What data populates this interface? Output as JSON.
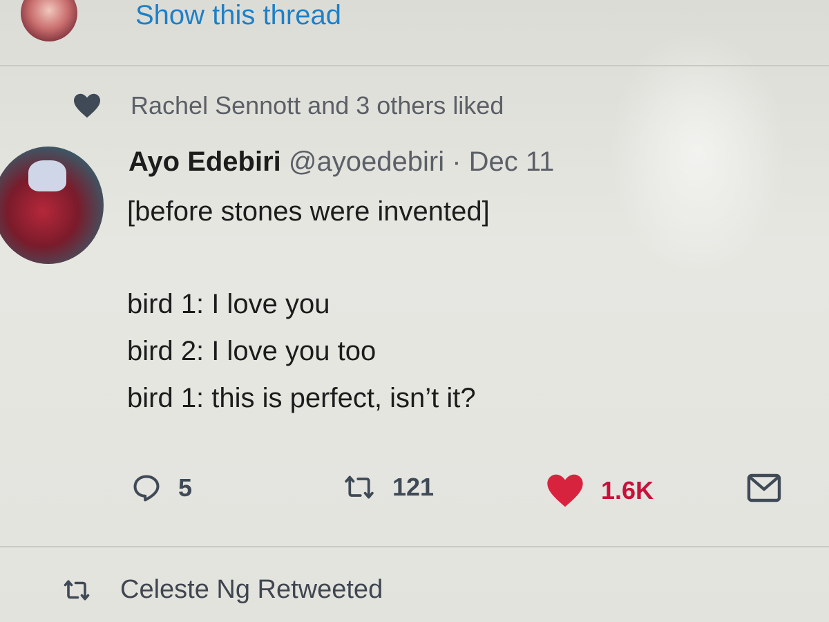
{
  "thread": {
    "show_thread_label": "Show this thread"
  },
  "social_context": {
    "liked_text": "Rachel Sennott and 3 others liked"
  },
  "tweet": {
    "author_name": "Ayo Edebiri",
    "author_handle": "@ayoedebiri",
    "separator": " · ",
    "date": "Dec 11",
    "lines": [
      "[before stones were invented]",
      "bird 1: I love you",
      "bird 2: I love you too",
      "bird 1: this is perfect, isn’t it?"
    ],
    "actions": {
      "replies": "5",
      "retweets": "121",
      "likes": "1.6K"
    }
  },
  "next_context": {
    "retweeted_text": "Celeste Ng Retweeted"
  },
  "colors": {
    "link_blue": "#1d80c8",
    "like_red": "#d8233f",
    "muted_text": "#5b5f66"
  },
  "icons": [
    "heart-icon",
    "reply-icon",
    "retweet-icon",
    "like-icon",
    "message-icon",
    "retweet-small-icon"
  ]
}
